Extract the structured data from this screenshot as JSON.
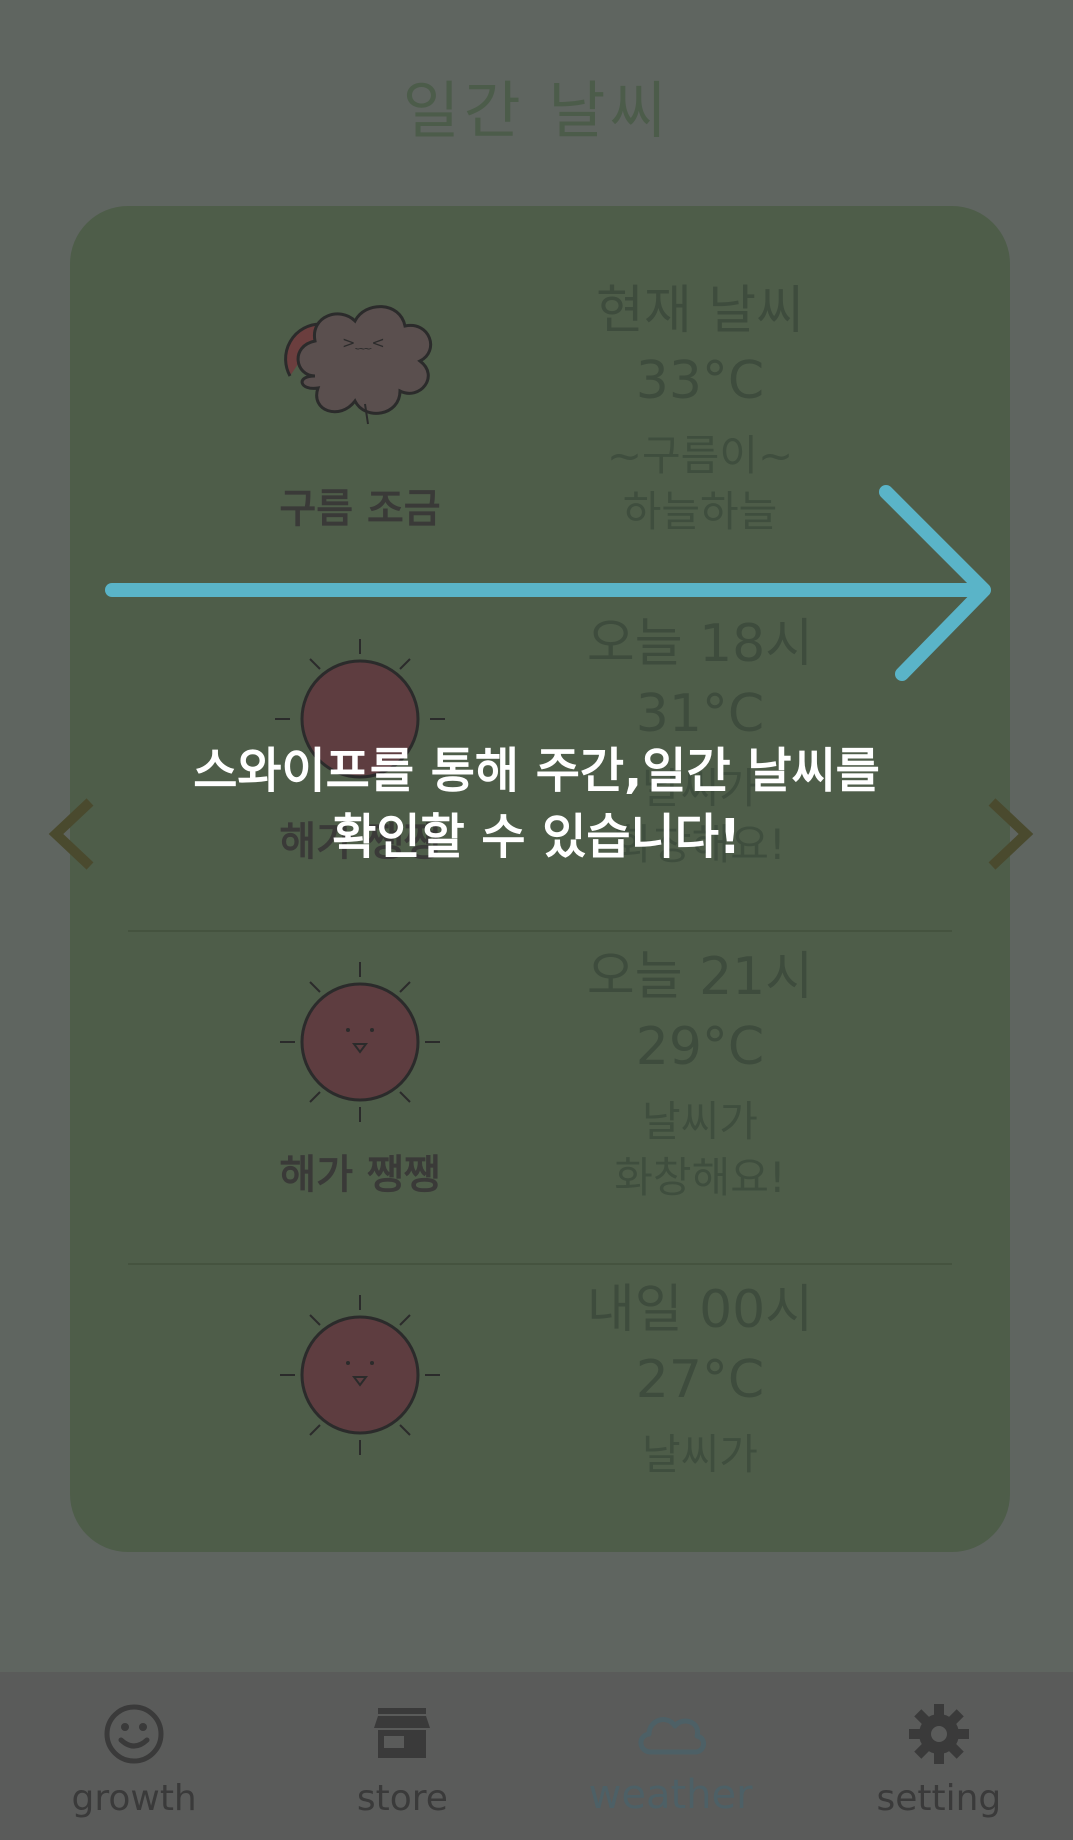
{
  "page": {
    "title": "일간 날씨"
  },
  "forecast": [
    {
      "time": "현재 날씨",
      "temp": "33°C",
      "desc_line1": "~구름이~",
      "desc_line2": "하늘하늘",
      "condition": "구름 조금",
      "icon": "cloud-icon"
    },
    {
      "time": "오늘 18시",
      "temp": "31°C",
      "desc_line1": "날씨가",
      "desc_line2": "화창해요!",
      "condition": "해가 쨍쨍",
      "icon": "sun-icon"
    },
    {
      "time": "오늘 21시",
      "temp": "29°C",
      "desc_line1": "날씨가",
      "desc_line2": "화창해요!",
      "condition": "해가 쨍쨍",
      "icon": "sun-icon"
    },
    {
      "time": "내일 00시",
      "temp": "27°C",
      "desc_line1": "날씨가",
      "desc_line2": "",
      "condition": "",
      "icon": "sun-icon"
    }
  ],
  "overlay": {
    "line1": "스와이프를 통해 주간,일간 날씨를",
    "line2": "확인할 수 있습니다!"
  },
  "bottom_nav": [
    {
      "label": "growth",
      "icon": "smiley-icon",
      "active": false
    },
    {
      "label": "store",
      "icon": "store-icon",
      "active": false
    },
    {
      "label": "weather",
      "icon": "cloud-outline-icon",
      "active": true
    },
    {
      "label": "setting",
      "icon": "gear-icon",
      "active": false
    }
  ],
  "colors": {
    "background": "#5f6560",
    "card": "#4e5d49",
    "swipe_arrow": "#5ab4c8",
    "overlay_text": "#ffffff",
    "active_tab": "#4d6066"
  }
}
